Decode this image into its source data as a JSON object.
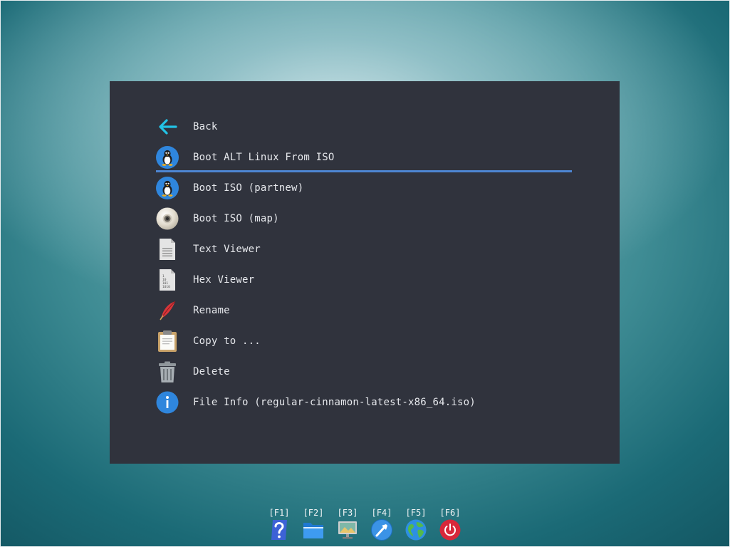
{
  "menu": {
    "items": [
      {
        "label": "Back",
        "icon": "back-arrow-icon"
      },
      {
        "label": "Boot ALT Linux From ISO",
        "icon": "tux-icon",
        "selected": true
      },
      {
        "label": "Boot ISO (partnew)",
        "icon": "tux-icon"
      },
      {
        "label": "Boot ISO (map)",
        "icon": "disc-icon"
      },
      {
        "label": "Text Viewer",
        "icon": "text-file-icon"
      },
      {
        "label": "Hex Viewer",
        "icon": "hex-file-icon"
      },
      {
        "label": "Rename",
        "icon": "quill-pen-icon"
      },
      {
        "label": "Copy to ...",
        "icon": "clipboard-icon"
      },
      {
        "label": "Delete",
        "icon": "trash-icon"
      },
      {
        "label": "File Info (regular-cinnamon-latest-x86_64.iso)",
        "icon": "info-icon"
      }
    ],
    "selection_color": "#4d86d3"
  },
  "taskbar": {
    "items": [
      {
        "key": "[F1]",
        "icon": "help-icon"
      },
      {
        "key": "[F2]",
        "icon": "folder-icon"
      },
      {
        "key": "[F3]",
        "icon": "monitor-icon"
      },
      {
        "key": "[F4]",
        "icon": "tools-icon"
      },
      {
        "key": "[F5]",
        "icon": "globe-icon"
      },
      {
        "key": "[F6]",
        "icon": "power-icon"
      }
    ]
  },
  "colors": {
    "panel_bg": "#30333d",
    "text": "#e6e8ec",
    "accent_cyan": "#22c3e6",
    "power_red": "#d8283a"
  }
}
